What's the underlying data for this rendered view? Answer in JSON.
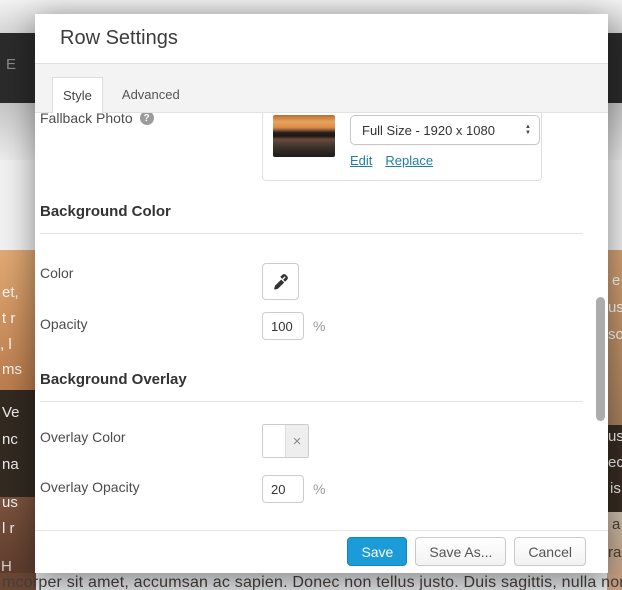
{
  "modal": {
    "title": "Row Settings",
    "tabs": [
      {
        "label": "Style",
        "active": true
      },
      {
        "label": "Advanced",
        "active": false
      }
    ],
    "content": {
      "fallback_photo": {
        "label": "Fallback Photo",
        "size_option": "Full Size - 1920 x 1080",
        "edit_link": "Edit",
        "replace_link": "Replace"
      },
      "sections": [
        {
          "heading": "Background Color"
        },
        {
          "heading": "Background Overlay"
        }
      ],
      "color": {
        "label": "Color"
      },
      "opacity": {
        "label": "Opacity",
        "value": "100",
        "unit": "%"
      },
      "overlay_color": {
        "label": "Overlay Color"
      },
      "overlay_opacity": {
        "label": "Overlay Opacity",
        "value": "20",
        "unit": "%"
      }
    },
    "footer": {
      "save": "Save",
      "save_as": "Save As...",
      "cancel": "Cancel"
    }
  },
  "icons": {
    "help": "?",
    "clear": "×",
    "stepper_up": "▲",
    "stepper_down": "▼"
  },
  "colors": {
    "accent_blue": "#1b9cd8",
    "link_blue": "#1f7fa3",
    "admin_bar": "#2b2b2b",
    "tab_bar": "#f3f3f3"
  },
  "backdrop": {
    "admin_bar_fragment": "E",
    "left_fragments": [
      "et,",
      "t r",
      ", l",
      "ms",
      "Ve",
      "nc",
      "na",
      "us",
      "l r",
      "H"
    ],
    "right_fragments": [
      "e",
      "us",
      "so",
      "us",
      "ec",
      "is"
    ],
    "right_dark_fragments": [
      "a",
      "ra"
    ],
    "bottom_text": "mcorper sit amet, accumsan ac sapien. Donec non tellus justo. Duis sagittis, nulla non preti"
  }
}
